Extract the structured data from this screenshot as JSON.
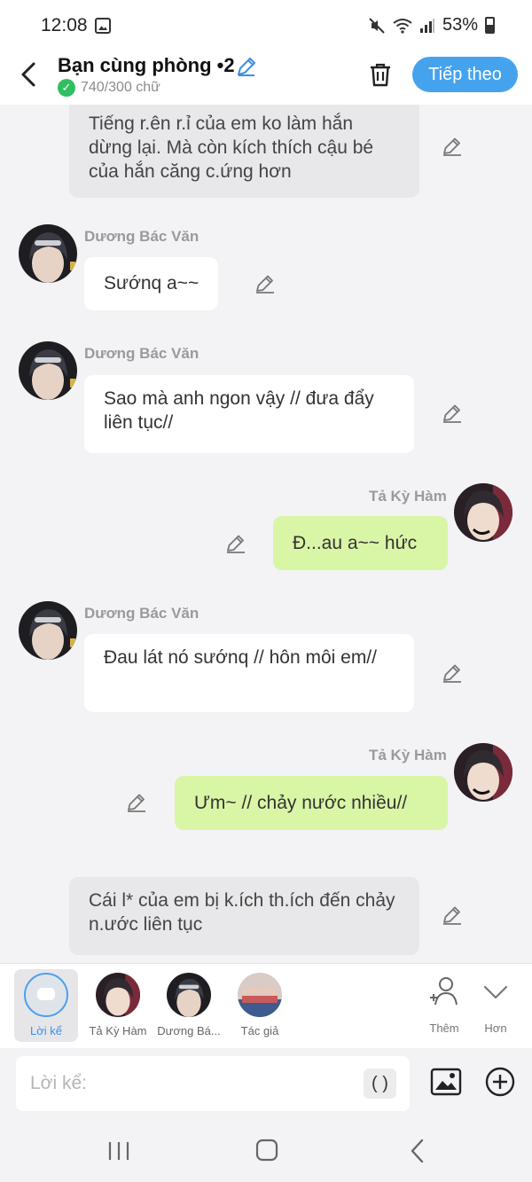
{
  "status_bar": {
    "time": "12:08",
    "battery": "53%"
  },
  "header": {
    "title": "Bạn cùng phòng •2",
    "word_count": "740/300 chữ",
    "next_label": "Tiếp theo"
  },
  "chat": {
    "messages": [
      {
        "kind": "narration",
        "text": "Tiếng r.ên r.ỉ của em ko làm hắn dừng lại. Mà còn kích thích cậu bé của hắn căng c.ứng hơn"
      },
      {
        "kind": "left",
        "speaker": "Dương Bác Văn",
        "text": "Sướnq a~~"
      },
      {
        "kind": "left",
        "speaker": "Dương Bác Văn",
        "text": "Sao mà anh ngon vậy // đưa đẩy liên tục//"
      },
      {
        "kind": "right",
        "speaker": "Tả Kỳ Hàm",
        "text": "Đ...au a~~ hức"
      },
      {
        "kind": "left",
        "speaker": "Dương Bác Văn",
        "text": "Đau lát nó sướnq // hôn môi em//"
      },
      {
        "kind": "right",
        "speaker": "Tả Kỳ Hàm",
        "text": "Ưm~ // chảy nước nhiều//"
      },
      {
        "kind": "narration",
        "text": "Cái l* của em bị k.ích th.ích đến chảy n.ước liên tục"
      }
    ]
  },
  "characters": {
    "items": [
      {
        "label": "Lời kể",
        "selected": true
      },
      {
        "label": "Tả Kỳ Hàm"
      },
      {
        "label": "Dương Bá..."
      },
      {
        "label": "Tác giả"
      }
    ],
    "add_label": "Thêm",
    "more_label": "Hơn"
  },
  "composer": {
    "placeholder": "Lời kể:",
    "paren_label": "( )"
  },
  "colors": {
    "accent": "#45a3ee",
    "right_bubble": "#d9f5a6",
    "narration_bubble": "#e8e8ea"
  }
}
